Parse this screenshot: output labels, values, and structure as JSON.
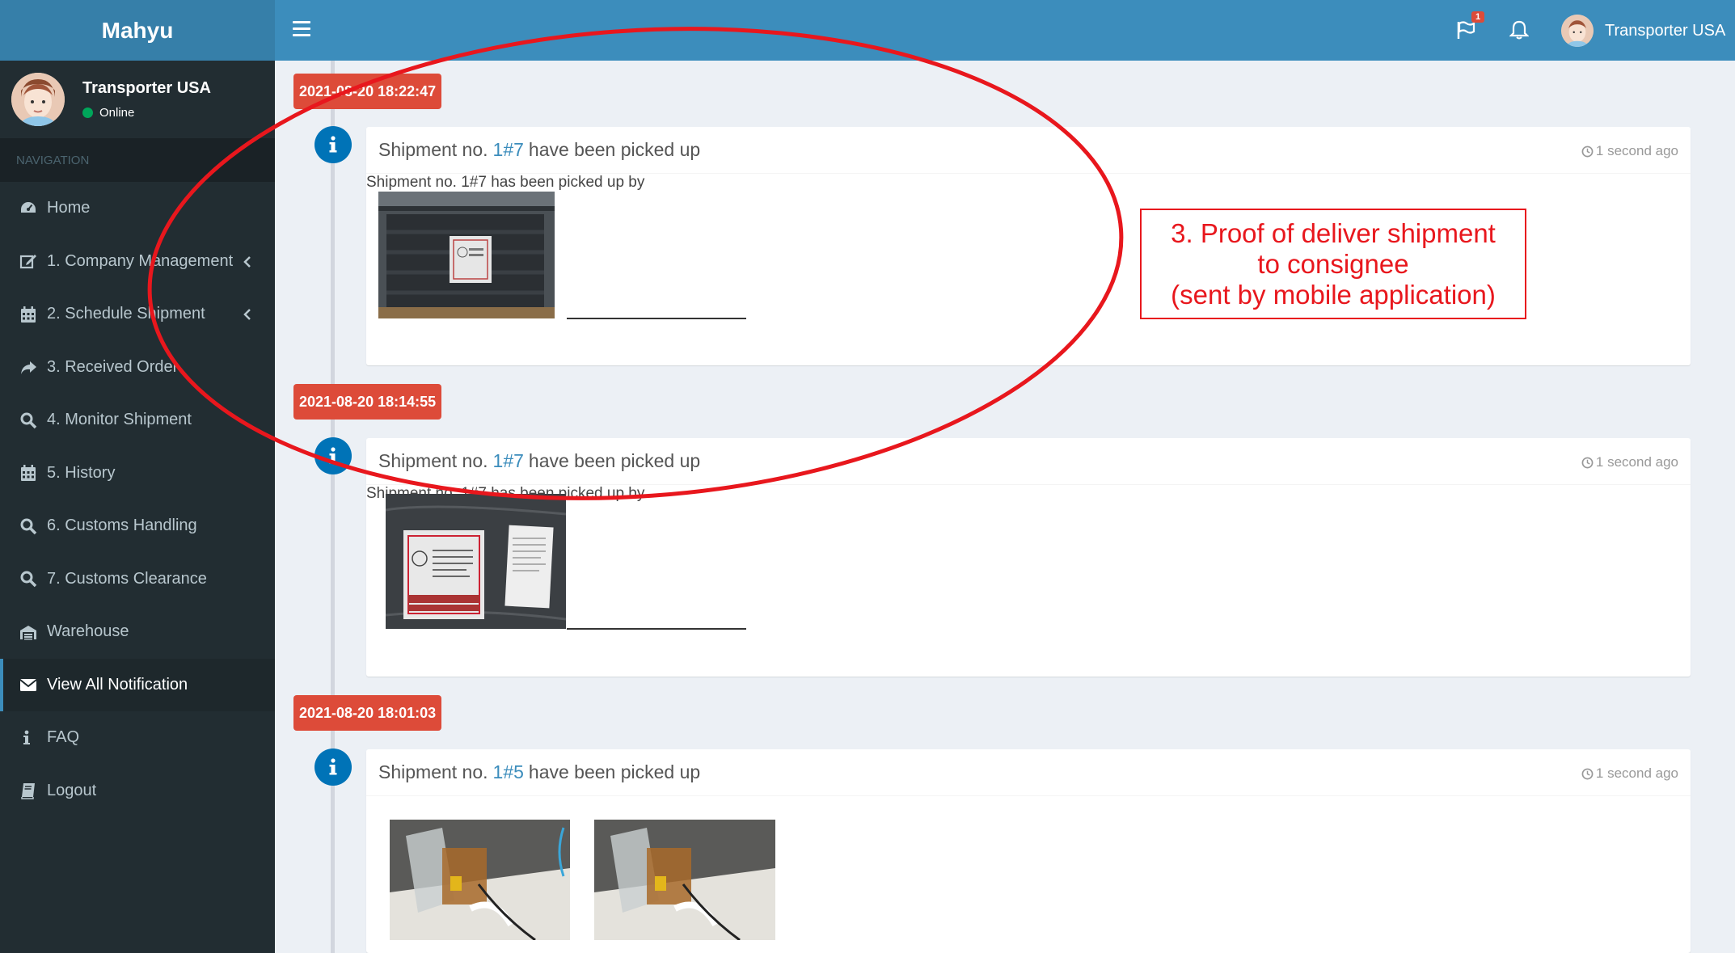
{
  "app": {
    "title": "Mahyu"
  },
  "user": {
    "name": "Transporter USA",
    "status": "Online"
  },
  "nav": {
    "header": "NAVIGATION",
    "items": [
      {
        "label": "Home",
        "icon": "dashboard-icon"
      },
      {
        "label": "1. Company Management",
        "icon": "edit-icon",
        "chevron": true
      },
      {
        "label": "2. Schedule Shipment",
        "icon": "calendar-icon",
        "chevron": true
      },
      {
        "label": "3. Received Order",
        "icon": "share-icon"
      },
      {
        "label": "4. Monitor Shipment",
        "icon": "search-icon"
      },
      {
        "label": "5. History",
        "icon": "calendar-icon"
      },
      {
        "label": "6. Customs Handling",
        "icon": "search-icon"
      },
      {
        "label": "7. Customs Clearance",
        "icon": "search-icon"
      },
      {
        "label": "Warehouse",
        "icon": "warehouse-icon"
      },
      {
        "label": "View All Notification",
        "icon": "envelope-icon",
        "active": true
      },
      {
        "label": "FAQ",
        "icon": "info-icon"
      },
      {
        "label": "Logout",
        "icon": "book-icon"
      }
    ]
  },
  "topbar": {
    "flag_badge": "1",
    "user_name": "Transporter USA"
  },
  "timeline": [
    {
      "time_label": "2021-08-20 18:22:47",
      "prefix": "Shipment no.",
      "shipment": "1#7",
      "suffix": "have been picked up",
      "ago": "1 second ago",
      "caption": "Shipment no. 1#7 has been picked up by"
    },
    {
      "time_label": "2021-08-20 18:14:55",
      "prefix": "Shipment no.",
      "shipment": "1#7",
      "suffix": "have been picked up",
      "ago": "1 second ago",
      "caption": "Shipment no. 1#7 has been picked up by"
    },
    {
      "time_label": "2021-08-20 18:01:03",
      "prefix": "Shipment no.",
      "shipment": "1#5",
      "suffix": "have been picked up",
      "ago": "1 second ago",
      "caption": ""
    }
  ],
  "annotation": {
    "lines": [
      "3. Proof of deliver shipment",
      "to consignee",
      "(sent by mobile application)"
    ],
    "color": "#e8171d"
  },
  "colors": {
    "topbar": "#3c8dbc",
    "sidebar": "#222d32",
    "time_label": "#dd4b39",
    "icon_blue": "#0073b7"
  }
}
